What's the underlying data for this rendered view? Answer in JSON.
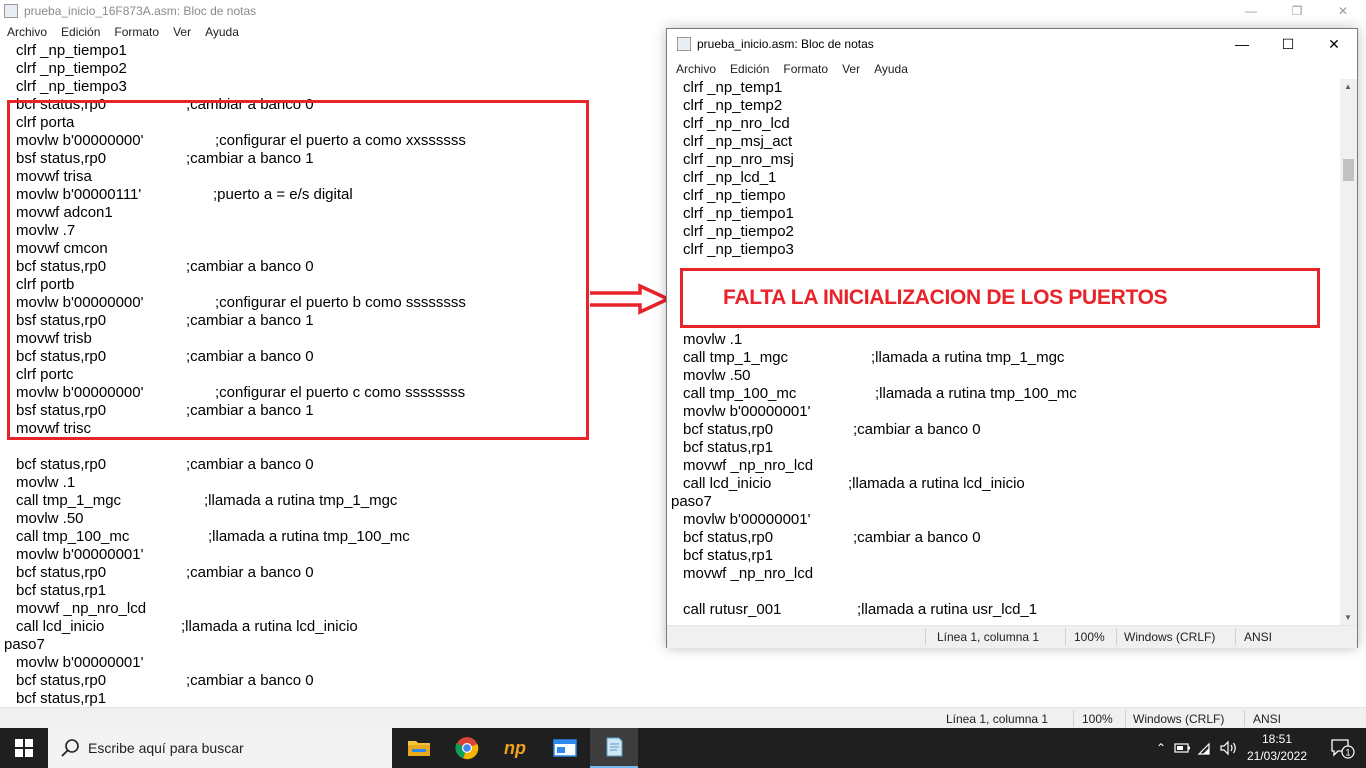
{
  "back_window": {
    "title": "prueba_inicio_16F873A.asm: Bloc de notas",
    "menu": [
      "Archivo",
      "Edición",
      "Formato",
      "Ver",
      "Ayuda"
    ],
    "lines": [
      {
        "code": "clrf _np_tiempo1",
        "comment": ""
      },
      {
        "code": "clrf _np_tiempo2",
        "comment": ""
      },
      {
        "code": "clrf _np_tiempo3",
        "comment": ""
      },
      {
        "code": "bcf status,rp0",
        "comment": ";cambiar a banco 0"
      },
      {
        "code": "clrf porta",
        "comment": ""
      },
      {
        "code": "movlw b'00000000'",
        "comment": ";configurar el puerto a como xxssssss"
      },
      {
        "code": "bsf status,rp0",
        "comment": ";cambiar a banco 1"
      },
      {
        "code": "movwf trisa",
        "comment": ""
      },
      {
        "code": "movlw b'00000111'",
        "comment": ";puerto a = e/s digital"
      },
      {
        "code": "movwf adcon1",
        "comment": ""
      },
      {
        "code": "movlw .7",
        "comment": ""
      },
      {
        "code": "movwf cmcon",
        "comment": ""
      },
      {
        "code": "bcf status,rp0",
        "comment": ";cambiar a banco 0"
      },
      {
        "code": "clrf portb",
        "comment": ""
      },
      {
        "code": "movlw b'00000000'",
        "comment": ";configurar el puerto b como ssssssss"
      },
      {
        "code": "bsf status,rp0",
        "comment": ";cambiar a banco 1"
      },
      {
        "code": "movwf trisb",
        "comment": ""
      },
      {
        "code": "bcf status,rp0",
        "comment": ";cambiar a banco 0"
      },
      {
        "code": "clrf portc",
        "comment": ""
      },
      {
        "code": "movlw b'00000000'",
        "comment": ";configurar el puerto c como ssssssss"
      },
      {
        "code": "bsf status,rp0",
        "comment": ";cambiar a banco 1"
      },
      {
        "code": "movwf trisc",
        "comment": ""
      },
      {
        "code": "",
        "comment": ""
      },
      {
        "code": "bcf status,rp0",
        "comment": ";cambiar a banco 0"
      },
      {
        "code": "movlw .1",
        "comment": ""
      },
      {
        "code": "call tmp_1_mgc",
        "comment": ";llamada a rutina tmp_1_mgc"
      },
      {
        "code": "movlw .50",
        "comment": ""
      },
      {
        "code": "call tmp_100_mc",
        "comment": ";llamada a rutina tmp_100_mc"
      },
      {
        "code": "movlw b'00000001'",
        "comment": ""
      },
      {
        "code": "bcf status,rp0",
        "comment": ";cambiar a banco 0"
      },
      {
        "code": "bcf status,rp1",
        "comment": ""
      },
      {
        "code": "movwf _np_nro_lcd",
        "comment": ""
      },
      {
        "code": "call lcd_inicio",
        "comment": ";llamada a rutina lcd_inicio"
      },
      {
        "code": "paso7",
        "comment": "",
        "label": true
      },
      {
        "code": "movlw b'00000001'",
        "comment": ""
      },
      {
        "code": "bcf status,rp0",
        "comment": ";cambiar a banco 0"
      },
      {
        "code": "bcf status,rp1",
        "comment": ""
      }
    ],
    "status": {
      "position": "Línea 1, columna 1",
      "zoom": "100%",
      "eol": "Windows (CRLF)",
      "encoding": "ANSI"
    }
  },
  "front_window": {
    "title": "prueba_inicio.asm: Bloc de notas",
    "menu": [
      "Archivo",
      "Edición",
      "Formato",
      "Ver",
      "Ayuda"
    ],
    "lines_top": [
      {
        "code": "clrf _np_temp1"
      },
      {
        "code": "clrf _np_temp2"
      },
      {
        "code": "clrf _np_nro_lcd"
      },
      {
        "code": "clrf _np_msj_act"
      },
      {
        "code": "clrf _np_nro_msj"
      },
      {
        "code": "clrf _np_lcd_1"
      },
      {
        "code": "clrf _np_tiempo"
      },
      {
        "code": "clrf _np_tiempo1"
      },
      {
        "code": "clrf _np_tiempo2"
      },
      {
        "code": "clrf _np_tiempo3"
      }
    ],
    "annotation": "FALTA LA INICIALIZACION DE LOS PUERTOS",
    "lines_bottom": [
      {
        "code": "movlw .1",
        "comment": ""
      },
      {
        "code": "call tmp_1_mgc",
        "comment": ";llamada a rutina tmp_1_mgc"
      },
      {
        "code": "movlw .50",
        "comment": ""
      },
      {
        "code": "call tmp_100_mc",
        "comment": ";llamada a rutina tmp_100_mc"
      },
      {
        "code": "movlw b'00000001'",
        "comment": ""
      },
      {
        "code": "bcf status,rp0",
        "comment": ";cambiar a banco 0"
      },
      {
        "code": "bcf status,rp1",
        "comment": ""
      },
      {
        "code": "movwf _np_nro_lcd",
        "comment": ""
      },
      {
        "code": "call lcd_inicio",
        "comment": ";llamada a rutina lcd_inicio"
      },
      {
        "code": "paso7",
        "comment": "",
        "label": true
      },
      {
        "code": "movlw b'00000001'",
        "comment": ""
      },
      {
        "code": "bcf status,rp0",
        "comment": ";cambiar a banco 0"
      },
      {
        "code": "bcf status,rp1",
        "comment": ""
      },
      {
        "code": "movwf _np_nro_lcd",
        "comment": ""
      },
      {
        "code": "",
        "comment": ""
      },
      {
        "code": "call rutusr_001",
        "comment": ";llamada a rutina usr_lcd_1"
      }
    ],
    "status": {
      "position": "Línea 1, columna 1",
      "zoom": "100%",
      "eol": "Windows (CRLF)",
      "encoding": "ANSI"
    }
  },
  "taskbar": {
    "search_placeholder": "Escribe aquí para buscar",
    "np_label": "np",
    "time": "18:51",
    "date": "21/03/2022",
    "notification_count": "1"
  }
}
